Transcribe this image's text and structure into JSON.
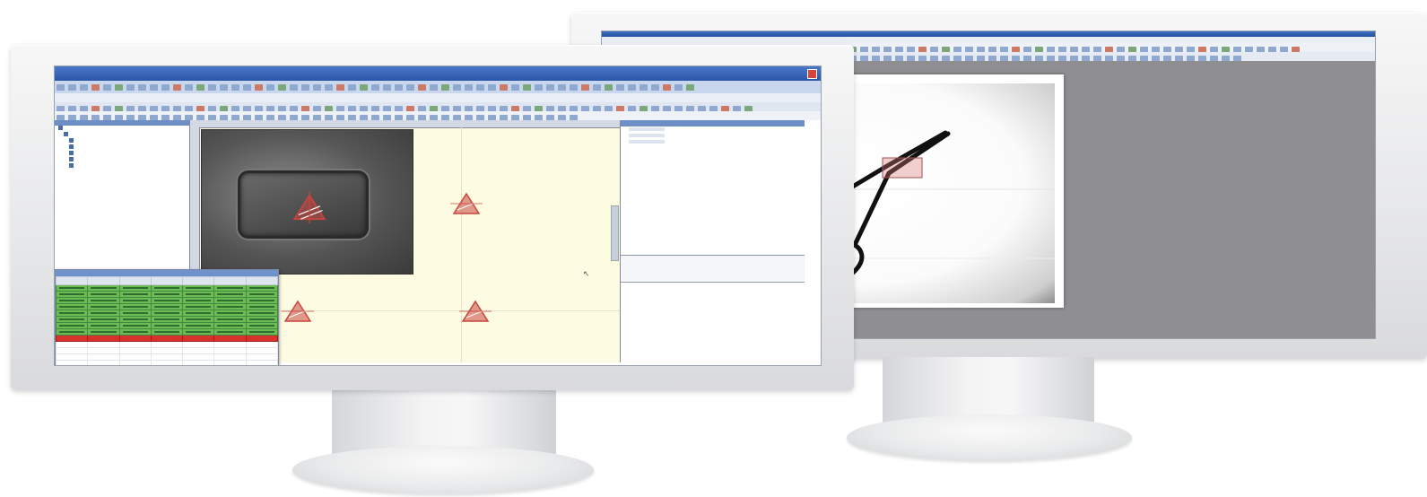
{
  "left_app": {
    "title": "",
    "menus": [
      "",
      "",
      "",
      "",
      "",
      ""
    ],
    "data_table": {
      "columns": [
        "",
        "",
        "",
        "",
        "",
        "",
        ""
      ],
      "row_count_green": 8,
      "row_count_red": 1,
      "row_count_empty": 5
    }
  },
  "right_app": {
    "menus": [
      "",
      "",
      "",
      "",
      "",
      "",
      ""
    ]
  },
  "colors": {
    "title_blue": "#2a56a8",
    "canvas_yellow": "#fdfce3",
    "grid_green": "#6cbb55",
    "row_red": "#d8322c",
    "marker_red": "#c9453e",
    "tool_highlight": "#e06a6a"
  },
  "icons": {
    "marker": "fiducial-marker-icon",
    "tool": "toolbar-button-icon",
    "cursor": "mouse-cursor-icon"
  }
}
